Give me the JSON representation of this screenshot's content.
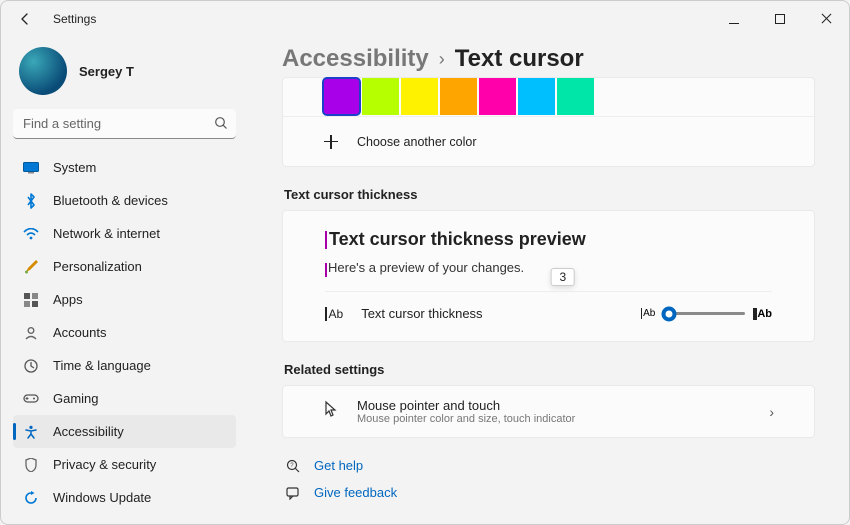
{
  "window": {
    "title": "Settings"
  },
  "user": {
    "name": "Sergey T"
  },
  "search": {
    "placeholder": "Find a setting"
  },
  "sidebar": {
    "items": [
      {
        "label": "System"
      },
      {
        "label": "Bluetooth & devices"
      },
      {
        "label": "Network & internet"
      },
      {
        "label": "Personalization"
      },
      {
        "label": "Apps"
      },
      {
        "label": "Accounts"
      },
      {
        "label": "Time & language"
      },
      {
        "label": "Gaming"
      },
      {
        "label": "Accessibility"
      },
      {
        "label": "Privacy & security"
      },
      {
        "label": "Windows Update"
      }
    ]
  },
  "breadcrumb": {
    "parent": "Accessibility",
    "current": "Text cursor"
  },
  "colors": {
    "swatches": [
      "#a800e8",
      "#b6ff00",
      "#fff200",
      "#ffa500",
      "#ff00aa",
      "#00bfff",
      "#00e6a8"
    ],
    "choose_label": "Choose another color"
  },
  "sections": {
    "thickness_label": "Text cursor thickness",
    "preview_title": "Text cursor thickness preview",
    "preview_text": "Here's a preview of your changes.",
    "slider_label": "Text cursor thickness",
    "slider_value": "3",
    "related_label": "Related settings",
    "mouse_title": "Mouse pointer and touch",
    "mouse_sub": "Mouse pointer color and size, touch indicator"
  },
  "help": {
    "get_help": "Get help",
    "feedback": "Give feedback"
  }
}
